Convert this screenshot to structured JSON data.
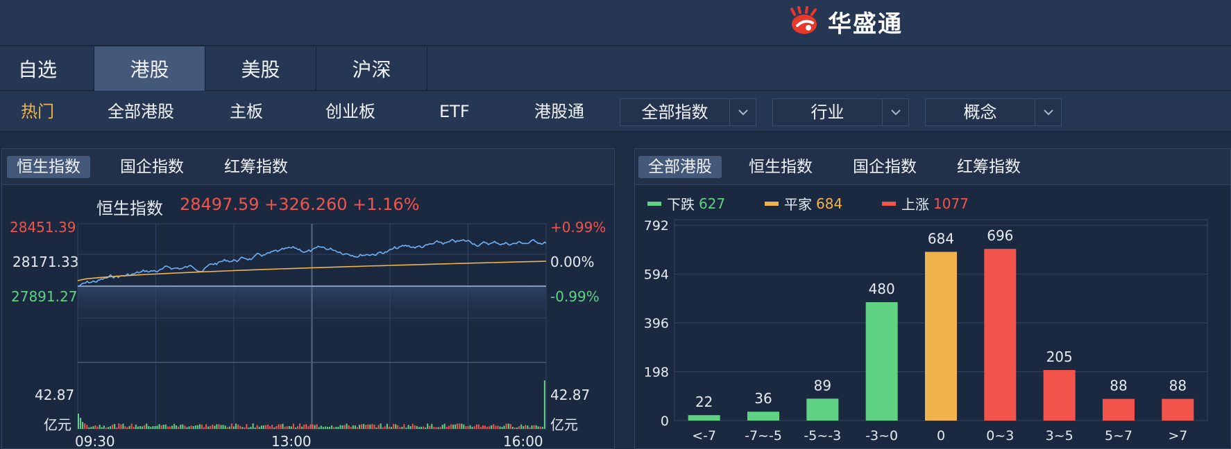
{
  "header": {
    "logo_text": "华盛通"
  },
  "market_tabs": [
    {
      "label": "自选",
      "active": false
    },
    {
      "label": "港股",
      "active": true
    },
    {
      "label": "美股",
      "active": false
    },
    {
      "label": "沪深",
      "active": false
    }
  ],
  "sub_tabs": {
    "hot": "热门",
    "all_hk": "全部港股",
    "main_board": "主板",
    "gem": "创业板",
    "etf": "ETF",
    "hk_connect": "港股通"
  },
  "dropdowns": {
    "all_index": "全部指数",
    "industry": "行业",
    "concept": "概念"
  },
  "index_panel": {
    "tabs": [
      {
        "label": "恒生指数",
        "active": true
      },
      {
        "label": "国企指数",
        "active": false
      },
      {
        "label": "红筹指数",
        "active": false
      }
    ],
    "title": "恒生指数",
    "price": "28497.59",
    "change": "+326.260",
    "change_pct": "+1.16%",
    "price_high": "28451.39",
    "price_base": "28171.33",
    "price_low": "27891.27",
    "pct_high": "+0.99%",
    "pct_base": "0.00%",
    "pct_low": "-0.99%",
    "volume_max": "42.87",
    "volume_unit": "亿元",
    "time_start": "09:30",
    "time_mid": "13:00",
    "time_end": "16:00",
    "colors": {
      "price_line": "#6fb0f5",
      "avg_line": "#f1b44c",
      "up": "#f2544b",
      "down": "#5fd284"
    }
  },
  "breadth_panel": {
    "tabs": [
      {
        "label": "全部港股",
        "active": true
      },
      {
        "label": "恒生指数",
        "active": false
      },
      {
        "label": "国企指数",
        "active": false
      },
      {
        "label": "红筹指数",
        "active": false
      }
    ],
    "legend": [
      {
        "name": "下跌",
        "count": "627",
        "color": "#5fd284"
      },
      {
        "name": "平家",
        "count": "684",
        "color": "#f1b44c"
      },
      {
        "name": "上涨",
        "count": "1077",
        "color": "#f2544b"
      }
    ]
  },
  "chart_data": {
    "type": "bar",
    "categories": [
      "<-7",
      "-7~-5",
      "-5~-3",
      "-3~0",
      "0",
      "0~3",
      "3~5",
      "5~7",
      ">7"
    ],
    "values": [
      22,
      36,
      89,
      480,
      684,
      696,
      205,
      88,
      88
    ],
    "colors": [
      "#5fd284",
      "#5fd284",
      "#5fd284",
      "#5fd284",
      "#f1b44c",
      "#f2544b",
      "#f2544b",
      "#f2544b",
      "#f2544b"
    ],
    "yticks": [
      "0",
      "198",
      "396",
      "594",
      "792"
    ],
    "ylim": [
      0,
      792
    ]
  }
}
